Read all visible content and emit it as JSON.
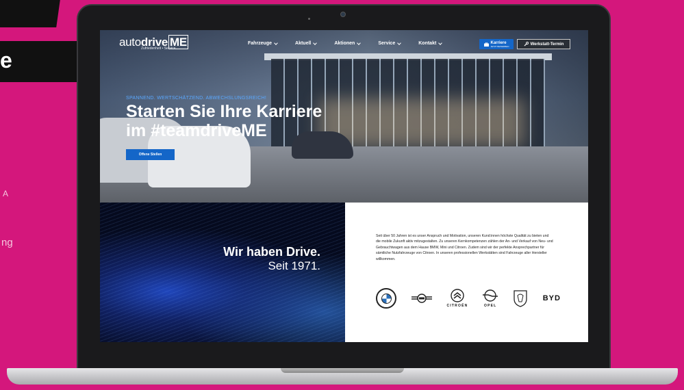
{
  "side": {
    "letter": "e",
    "frag1": "A",
    "frag2": "ng"
  },
  "nav": {
    "logo_plain": "auto",
    "logo_bold": "drive",
    "logo_me": "ME",
    "logo_tagline": "Zufriedenheit • Service",
    "menu": [
      {
        "label": "Fahrzeuge"
      },
      {
        "label": "Aktuell"
      },
      {
        "label": "Aktionen"
      },
      {
        "label": "Service"
      },
      {
        "label": "Kontakt"
      }
    ],
    "karriere_label": "Karriere",
    "karriere_sub": "JETZT BEWERBEN",
    "werkstatt_label": "Werkstatt-Termin"
  },
  "hero": {
    "kicker": "SPANNEND. WERTSCHÄTZEND. ABWECHSLUNGSREICH!",
    "title_line1": "Starten Sie Ihre Karriere",
    "title_line2": "im #teamdriveME",
    "button": "Offene Stellen"
  },
  "drive": {
    "title": "Wir haben Drive.",
    "subtitle": "Seit 1971."
  },
  "about": {
    "text": "Seit über 50 Jahren ist es unser Anspruch und Motivation, unseren Kund:innen höchste Qualität zu bieten und die mobile Zukunft aktiv mitzugestalten. Zu unseren Kernkompetenzen zählen der An- und Verkauf von Neu- und Gebrauchtwagen aus dem Hause BMW, Mini und Citroen. Zudem sind wir der perfekte Ansprechpartner für sämtliche Nutzfahrzeuge von Citroen. In unseren professionellen Werkstätten sind Fahrzeuge aller Hersteller willkommen.",
    "brands": [
      {
        "name": "bmw",
        "label": ""
      },
      {
        "name": "mini",
        "label": ""
      },
      {
        "name": "citroen",
        "label": "CITROËN"
      },
      {
        "name": "opel",
        "label": "OPEL"
      },
      {
        "name": "peugeot",
        "label": ""
      },
      {
        "name": "byd",
        "label": "BYD"
      }
    ]
  },
  "colors": {
    "background": "#d4177c",
    "accent": "#1466c8"
  }
}
